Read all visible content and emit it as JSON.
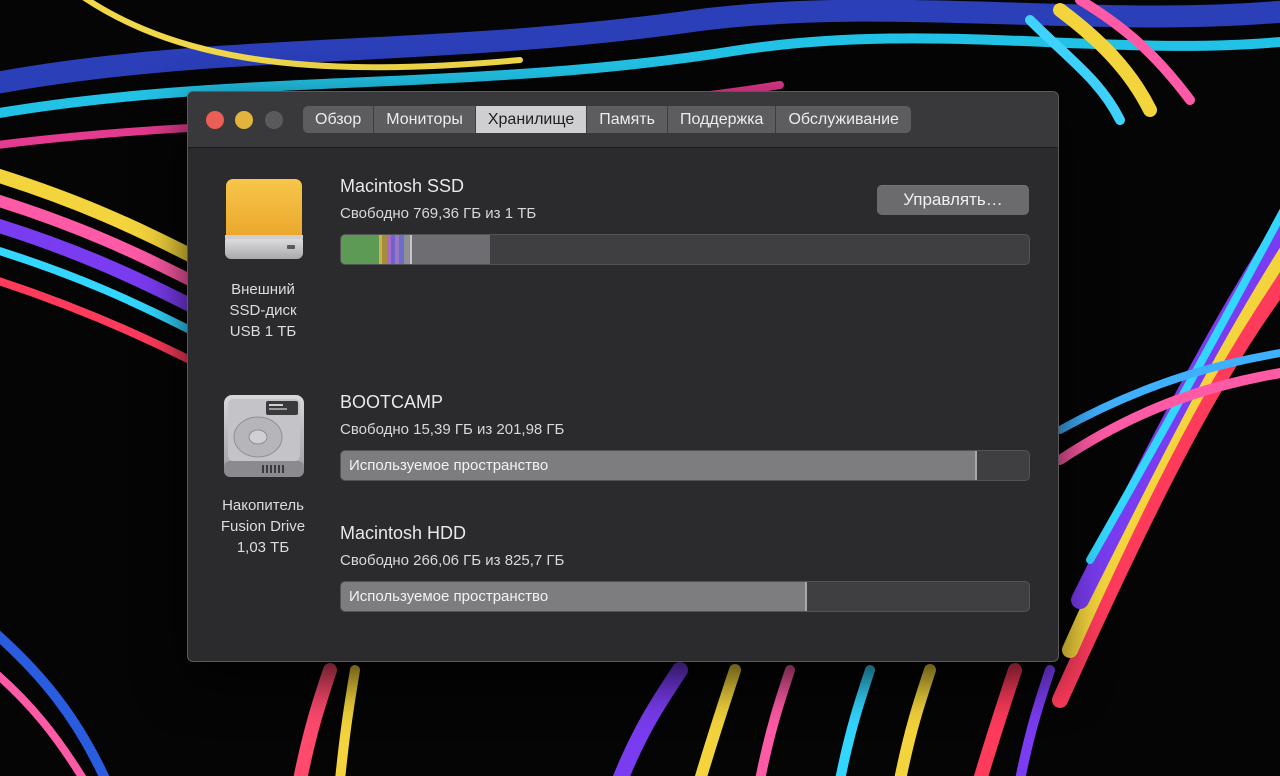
{
  "window": {
    "tabs": [
      {
        "label": "Обзор",
        "active": false
      },
      {
        "label": "Мониторы",
        "active": false
      },
      {
        "label": "Хранилище",
        "active": true
      },
      {
        "label": "Память",
        "active": false
      },
      {
        "label": "Поддержка",
        "active": false
      },
      {
        "label": "Обслуживание",
        "active": false
      }
    ],
    "traffic_lights": {
      "close": "#ec5f57",
      "minimize": "#e2b43c",
      "zoom": "#5a5a5c"
    }
  },
  "devices": [
    {
      "icon": "external-ssd-icon",
      "label_lines": [
        "Внешний",
        "SSD-диск",
        "USB 1 ТБ"
      ],
      "volumes": [
        {
          "name": "Macintosh SSD",
          "free_text": "Свободно 769,36 ГБ из 1 ТБ",
          "manage_label": "Управлять…",
          "segments": [
            {
              "fraction": 0.055,
              "color": "#5d9a56"
            },
            {
              "fraction": 0.004,
              "color": "#c9b34a"
            },
            {
              "fraction": 0.008,
              "color": "#a58d3c"
            },
            {
              "fraction": 0.006,
              "color": "#a96ac7"
            },
            {
              "fraction": 0.005,
              "color": "#6f64c9"
            },
            {
              "fraction": 0.007,
              "color": "#9b78c4"
            },
            {
              "fraction": 0.007,
              "color": "#6a6ec8"
            },
            {
              "fraction": 0.008,
              "color": "#8f8f94"
            },
            {
              "fraction": 0.003,
              "color": "#c4c4c6"
            },
            {
              "fraction": 0.114,
              "color": "#6e6e72"
            }
          ]
        }
      ]
    },
    {
      "icon": "hard-drive-icon",
      "label_lines": [
        "Накопитель",
        "Fusion Drive",
        "1,03 ТБ"
      ],
      "volumes": [
        {
          "name": "BOOTCAMP",
          "free_text": "Свободно 15,39 ГБ из 201,98 ГБ",
          "used_label": "Используемое пространство",
          "used_fraction": 0.924
        },
        {
          "name": "Macintosh HDD",
          "free_text": "Свободно 266,06 ГБ из 825,7 ГБ",
          "used_label": "Используемое пространство",
          "used_fraction": 0.678
        }
      ]
    }
  ]
}
